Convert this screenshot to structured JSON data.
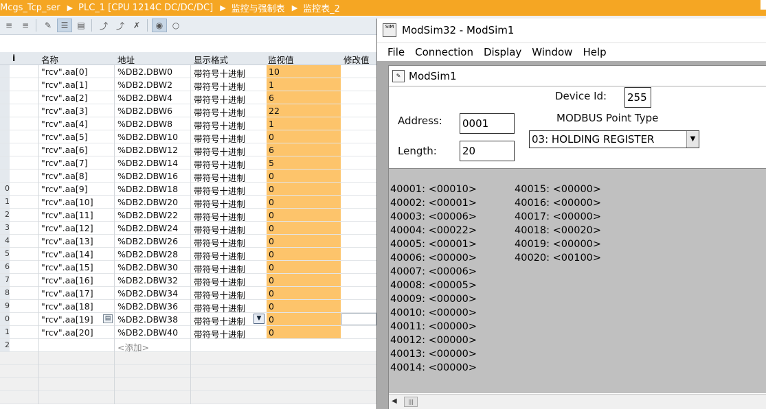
{
  "breadcrumb": {
    "items": [
      "Mcgs_Tcp_ser",
      "PLC_1 [CPU 1214C DC/DC/DC]",
      "监控与强制表",
      "监控表_2"
    ]
  },
  "toolbar": {
    "icons": [
      "modify-value-icon",
      "modify-all-icon",
      "edit-icon",
      "monitor-icon",
      "monitor-once-icon",
      "force-icon",
      "force-all-icon",
      "unforce-icon",
      "show-hide-icon",
      "expanded-mode-icon"
    ]
  },
  "table": {
    "headers": {
      "info": "i",
      "name": "名称",
      "address": "地址",
      "format": "显示格式",
      "monitor": "监视值",
      "modify": "修改值"
    },
    "rows": [
      {
        "idx": "",
        "name": "\"rcv\".aa[0]",
        "address": "%DB2.DBW0",
        "format": "带符号十进制",
        "value": "10"
      },
      {
        "idx": "",
        "name": "\"rcv\".aa[1]",
        "address": "%DB2.DBW2",
        "format": "带符号十进制",
        "value": "1"
      },
      {
        "idx": "",
        "name": "\"rcv\".aa[2]",
        "address": "%DB2.DBW4",
        "format": "带符号十进制",
        "value": "6"
      },
      {
        "idx": "",
        "name": "\"rcv\".aa[3]",
        "address": "%DB2.DBW6",
        "format": "带符号十进制",
        "value": "22"
      },
      {
        "idx": "",
        "name": "\"rcv\".aa[4]",
        "address": "%DB2.DBW8",
        "format": "带符号十进制",
        "value": "1"
      },
      {
        "idx": "",
        "name": "\"rcv\".aa[5]",
        "address": "%DB2.DBW10",
        "format": "带符号十进制",
        "value": "0"
      },
      {
        "idx": "",
        "name": "\"rcv\".aa[6]",
        "address": "%DB2.DBW12",
        "format": "带符号十进制",
        "value": "6"
      },
      {
        "idx": "",
        "name": "\"rcv\".aa[7]",
        "address": "%DB2.DBW14",
        "format": "带符号十进制",
        "value": "5"
      },
      {
        "idx": "",
        "name": "\"rcv\".aa[8]",
        "address": "%DB2.DBW16",
        "format": "带符号十进制",
        "value": "0"
      },
      {
        "idx": "0",
        "name": "\"rcv\".aa[9]",
        "address": "%DB2.DBW18",
        "format": "带符号十进制",
        "value": "0"
      },
      {
        "idx": "1",
        "name": "\"rcv\".aa[10]",
        "address": "%DB2.DBW20",
        "format": "带符号十进制",
        "value": "0"
      },
      {
        "idx": "2",
        "name": "\"rcv\".aa[11]",
        "address": "%DB2.DBW22",
        "format": "带符号十进制",
        "value": "0"
      },
      {
        "idx": "3",
        "name": "\"rcv\".aa[12]",
        "address": "%DB2.DBW24",
        "format": "带符号十进制",
        "value": "0"
      },
      {
        "idx": "4",
        "name": "\"rcv\".aa[13]",
        "address": "%DB2.DBW26",
        "format": "带符号十进制",
        "value": "0"
      },
      {
        "idx": "5",
        "name": "\"rcv\".aa[14]",
        "address": "%DB2.DBW28",
        "format": "带符号十进制",
        "value": "0"
      },
      {
        "idx": "6",
        "name": "\"rcv\".aa[15]",
        "address": "%DB2.DBW30",
        "format": "带符号十进制",
        "value": "0"
      },
      {
        "idx": "7",
        "name": "\"rcv\".aa[16]",
        "address": "%DB2.DBW32",
        "format": "带符号十进制",
        "value": "0"
      },
      {
        "idx": "8",
        "name": "\"rcv\".aa[17]",
        "address": "%DB2.DBW34",
        "format": "带符号十进制",
        "value": "0"
      },
      {
        "idx": "9",
        "name": "\"rcv\".aa[18]",
        "address": "%DB2.DBW36",
        "format": "带符号十进制",
        "value": "0"
      },
      {
        "idx": "0",
        "name": "\"rcv\".aa[19]",
        "address": "%DB2.DBW38",
        "format": "带符号十进制",
        "value": "0"
      },
      {
        "idx": "1",
        "name": "\"rcv\".aa[20]",
        "address": "%DB2.DBW40",
        "format": "带符号十进制",
        "value": "0"
      }
    ],
    "add_row": {
      "idx": "2",
      "hint": "<添加>"
    }
  },
  "modsim": {
    "window_title": "ModSim32 - ModSim1",
    "logo_text": "SIM",
    "menu": [
      "File",
      "Connection",
      "Display",
      "Window",
      "Help"
    ],
    "child_title": "ModSim1",
    "device_id_label": "Device Id:",
    "device_id": "255",
    "address_label": "Address:",
    "address": "0001",
    "length_label": "Length:",
    "length": "20",
    "point_type_label": "MODBUS Point Type",
    "point_type": "03: HOLDING REGISTER",
    "registers_col1": [
      "40001: <00010>",
      "40002: <00001>",
      "40003: <00006>",
      "40004: <00022>",
      "40005: <00001>",
      "40006: <00000>",
      "40007: <00006>",
      "40008: <00005>",
      "40009: <00000>",
      "40010: <00000>",
      "40011: <00000>",
      "40012: <00000>",
      "40013: <00000>",
      "40014: <00000>"
    ],
    "registers_col2": [
      "40015: <00000>",
      "40016: <00000>",
      "40017: <00000>",
      "40018: <00020>",
      "40019: <00000>",
      "40020: <00100>"
    ]
  },
  "colors": {
    "breadcrumb_bg": "#f5a623",
    "monitor_value_bg": "#fdc46b",
    "register_pane_bg": "#c0c0c0"
  }
}
